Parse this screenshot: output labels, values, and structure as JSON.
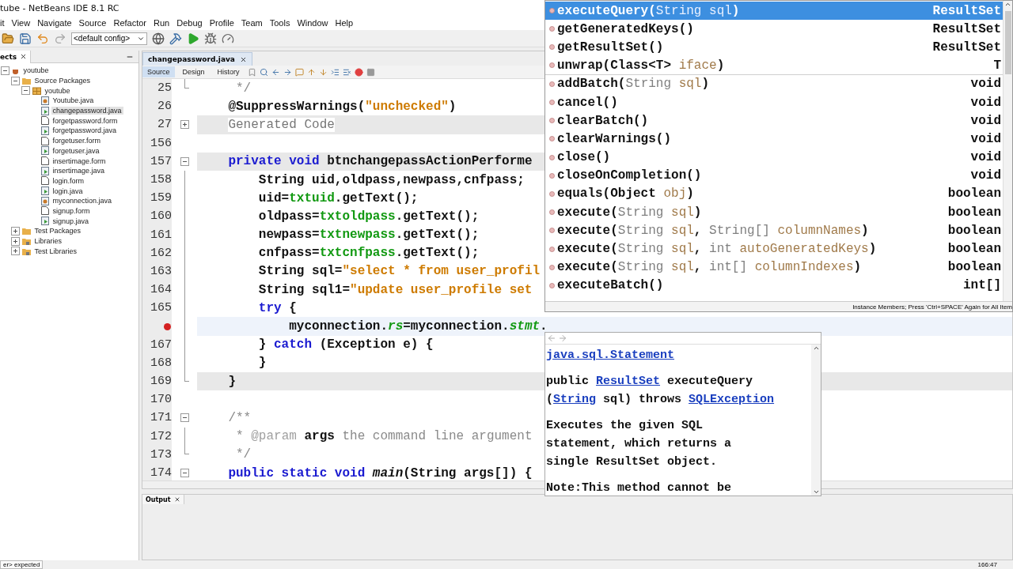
{
  "window": {
    "title": "tube - NetBeans IDE 8.1 RC"
  },
  "menu": [
    "it",
    "View",
    "Navigate",
    "Source",
    "Refactor",
    "Run",
    "Debug",
    "Profile",
    "Team",
    "Tools",
    "Window",
    "Help"
  ],
  "toolbar": {
    "config": "<default config>"
  },
  "projects": {
    "tab": "ects",
    "tree": [
      {
        "label": "youtube",
        "kind": "project",
        "expanded": true,
        "selected": false,
        "children": [
          {
            "label": "Source Packages",
            "kind": "folder",
            "expanded": true,
            "selected": false,
            "children": [
              {
                "label": "youtube",
                "kind": "package",
                "expanded": true,
                "selected": false,
                "children": [
                  {
                    "label": "Youtube.java",
                    "kind": "main",
                    "selected": false
                  },
                  {
                    "label": "changepassword.java",
                    "kind": "java",
                    "selected": true
                  },
                  {
                    "label": "forgetpassword.form",
                    "kind": "form",
                    "selected": false
                  },
                  {
                    "label": "forgetpassword.java",
                    "kind": "java",
                    "selected": false
                  },
                  {
                    "label": "forgetuser.form",
                    "kind": "form",
                    "selected": false
                  },
                  {
                    "label": "forgetuser.java",
                    "kind": "java",
                    "selected": false
                  },
                  {
                    "label": "insertimage.form",
                    "kind": "form",
                    "selected": false
                  },
                  {
                    "label": "insertimage.java",
                    "kind": "java",
                    "selected": false
                  },
                  {
                    "label": "login.form",
                    "kind": "form",
                    "selected": false
                  },
                  {
                    "label": "login.java",
                    "kind": "java",
                    "selected": false
                  },
                  {
                    "label": "myconnection.java",
                    "kind": "main",
                    "selected": false
                  },
                  {
                    "label": "signup.form",
                    "kind": "form",
                    "selected": false
                  },
                  {
                    "label": "signup.java",
                    "kind": "java",
                    "selected": false
                  }
                ]
              }
            ]
          },
          {
            "label": "Test Packages",
            "kind": "folder",
            "expanded": false,
            "selected": false
          },
          {
            "label": "Libraries",
            "kind": "library",
            "expanded": false,
            "selected": false
          },
          {
            "label": "Test Libraries",
            "kind": "library",
            "expanded": false,
            "selected": false
          }
        ]
      }
    ]
  },
  "editor": {
    "tab": "changepassword.java",
    "views": [
      {
        "label": "Source",
        "selected": true
      },
      {
        "label": "Design",
        "selected": false
      },
      {
        "label": "History",
        "selected": false
      }
    ],
    "lines": [
      {
        "number": "25",
        "kind": "normal",
        "fold": {
          "kind": "end"
        },
        "error": false,
        "tokens": [
          {
            "text": "     */",
            "kind": "comment"
          }
        ]
      },
      {
        "number": "26",
        "kind": "normal",
        "error": false,
        "tokens": [
          {
            "text": "    @SuppressWarnings(",
            "kind": "plain"
          },
          {
            "text": "\"unchecked\"",
            "kind": "string"
          },
          {
            "text": ")",
            "kind": "plain"
          }
        ]
      },
      {
        "number": "27",
        "kind": "guarded",
        "fold": {
          "kind": "expand"
        },
        "error": false,
        "tokens": [
          {
            "text": "    Generated Code",
            "kind": "folded"
          }
        ]
      },
      {
        "number": "156",
        "kind": "normal",
        "error": false
      },
      {
        "number": "157",
        "kind": "guarded",
        "fold": {
          "kind": "collapse"
        },
        "error": false,
        "tokens": [
          {
            "text": "    private void",
            "kind": "keyword"
          },
          {
            "text": " btnchangepassActionPerforme",
            "kind": "plain"
          }
        ]
      },
      {
        "number": "158",
        "kind": "normal",
        "fold": {
          "kind": "line"
        },
        "error": false,
        "tokens": [
          {
            "text": "        String uid,oldpass,newpass,cnfpass;",
            "kind": "plain"
          }
        ]
      },
      {
        "number": "159",
        "kind": "normal",
        "fold": {
          "kind": "line"
        },
        "error": false,
        "tokens": [
          {
            "text": "        uid=",
            "kind": "plain"
          },
          {
            "text": "txtuid",
            "kind": "field"
          },
          {
            "text": ".getText();",
            "kind": "plain"
          }
        ]
      },
      {
        "number": "160",
        "kind": "normal",
        "fold": {
          "kind": "line"
        },
        "error": false,
        "tokens": [
          {
            "text": "        oldpass=",
            "kind": "plain"
          },
          {
            "text": "txtoldpass",
            "kind": "field"
          },
          {
            "text": ".getText();",
            "kind": "plain"
          }
        ]
      },
      {
        "number": "161",
        "kind": "normal",
        "fold": {
          "kind": "line"
        },
        "error": false,
        "tokens": [
          {
            "text": "        newpass=",
            "kind": "plain"
          },
          {
            "text": "txtnewpass",
            "kind": "field"
          },
          {
            "text": ".getText();",
            "kind": "plain"
          }
        ]
      },
      {
        "number": "162",
        "kind": "normal",
        "fold": {
          "kind": "line"
        },
        "error": false,
        "tokens": [
          {
            "text": "        cnfpass=",
            "kind": "plain"
          },
          {
            "text": "txtcnfpass",
            "kind": "field"
          },
          {
            "text": ".getText();",
            "kind": "plain"
          }
        ]
      },
      {
        "number": "163",
        "kind": "normal",
        "fold": {
          "kind": "line"
        },
        "error": false,
        "tokens": [
          {
            "text": "        String sql=",
            "kind": "plain"
          },
          {
            "text": "\"select * from user_profil",
            "kind": "string"
          }
        ]
      },
      {
        "number": "164",
        "kind": "normal",
        "fold": {
          "kind": "line"
        },
        "error": false,
        "tokens": [
          {
            "text": "        String sql1=",
            "kind": "plain"
          },
          {
            "text": "\"update user_profile set",
            "kind": "string"
          }
        ]
      },
      {
        "number": "165",
        "kind": "normal",
        "fold": {
          "kind": "line"
        },
        "error": false,
        "tokens": [
          {
            "text": "        try",
            "kind": "keyword"
          },
          {
            "text": " {",
            "kind": "plain"
          }
        ]
      },
      {
        "kind": "caret",
        "fold": {
          "kind": "line"
        },
        "error": true,
        "tokens": [
          {
            "text": "            myconnection.",
            "kind": "plain"
          },
          {
            "text": "rs",
            "kind": "static"
          },
          {
            "text": "=myconnection.",
            "kind": "plain"
          },
          {
            "text": "stmt",
            "kind": "static"
          },
          {
            "text": ".",
            "kind": "plain"
          }
        ]
      },
      {
        "number": "167",
        "kind": "normal",
        "fold": {
          "kind": "line"
        },
        "error": false,
        "tokens": [
          {
            "text": "        } ",
            "kind": "plain"
          },
          {
            "text": "catch",
            "kind": "keyword"
          },
          {
            "text": " (Exception e) {",
            "kind": "plain"
          }
        ]
      },
      {
        "number": "168",
        "kind": "normal",
        "fold": {
          "kind": "line"
        },
        "error": false,
        "tokens": [
          {
            "text": "        }",
            "kind": "plain"
          }
        ]
      },
      {
        "number": "169",
        "kind": "guarded",
        "fold": {
          "kind": "end"
        },
        "error": false,
        "tokens": [
          {
            "text": "    }",
            "kind": "plain"
          }
        ]
      },
      {
        "number": "170",
        "kind": "normal",
        "error": false
      },
      {
        "number": "171",
        "kind": "normal",
        "fold": {
          "kind": "collapse"
        },
        "error": false,
        "tokens": [
          {
            "text": "    /**",
            "kind": "comment"
          }
        ]
      },
      {
        "number": "172",
        "kind": "normal",
        "fold": {
          "kind": "line"
        },
        "error": false,
        "tokens": [
          {
            "text": "     * ",
            "kind": "comment"
          },
          {
            "text": "@param",
            "kind": "tag"
          },
          {
            "text": " args",
            "kind": "plain"
          },
          {
            "text": " the command line argument",
            "kind": "comment"
          }
        ]
      },
      {
        "number": "173",
        "kind": "normal",
        "fold": {
          "kind": "end"
        },
        "error": false,
        "tokens": [
          {
            "text": "     */",
            "kind": "comment"
          }
        ]
      },
      {
        "number": "174",
        "kind": "normal",
        "fold": {
          "kind": "collapse"
        },
        "error": false,
        "tokens": [
          {
            "text": "    public static void ",
            "kind": "keyword"
          },
          {
            "text": "main",
            "kind": "italic"
          },
          {
            "text": "(String args[]) {",
            "kind": "plain"
          }
        ]
      }
    ]
  },
  "completion": {
    "items": [
      {
        "signature": [
          {
            "text": "executeQuery",
            "kind": "name"
          },
          {
            "text": "(",
            "kind": "punct"
          },
          {
            "text": "String",
            "kind": "type"
          },
          {
            "text": " sql",
            "kind": "param"
          },
          {
            "text": ")",
            "kind": "punct"
          }
        ],
        "type": "ResultSet",
        "selected": true,
        "separator": false
      },
      {
        "signature": [
          {
            "text": "getGeneratedKeys",
            "kind": "name"
          },
          {
            "text": "()",
            "kind": "punct"
          }
        ],
        "type": "ResultSet",
        "selected": false,
        "separator": false
      },
      {
        "signature": [
          {
            "text": "getResultSet",
            "kind": "name"
          },
          {
            "text": "()",
            "kind": "punct"
          }
        ],
        "type": "ResultSet",
        "selected": false,
        "separator": false
      },
      {
        "signature": [
          {
            "text": "unwrap",
            "kind": "name"
          },
          {
            "text": "(Class<T>",
            "kind": "punct"
          },
          {
            "text": " iface",
            "kind": "param"
          },
          {
            "text": ")",
            "kind": "punct"
          }
        ],
        "type": "T",
        "selected": false,
        "separator": true
      },
      {
        "signature": [
          {
            "text": "addBatch",
            "kind": "name"
          },
          {
            "text": "(",
            "kind": "punct"
          },
          {
            "text": "String",
            "kind": "type"
          },
          {
            "text": " sql",
            "kind": "param"
          },
          {
            "text": ")",
            "kind": "punct"
          }
        ],
        "type": "void",
        "selected": false,
        "separator": false
      },
      {
        "signature": [
          {
            "text": "cancel",
            "kind": "name"
          },
          {
            "text": "()",
            "kind": "punct"
          }
        ],
        "type": "void",
        "selected": false,
        "separator": false
      },
      {
        "signature": [
          {
            "text": "clearBatch",
            "kind": "name"
          },
          {
            "text": "()",
            "kind": "punct"
          }
        ],
        "type": "void",
        "selected": false,
        "separator": false
      },
      {
        "signature": [
          {
            "text": "clearWarnings",
            "kind": "name"
          },
          {
            "text": "()",
            "kind": "punct"
          }
        ],
        "type": "void",
        "selected": false,
        "separator": false
      },
      {
        "signature": [
          {
            "text": "close",
            "kind": "name"
          },
          {
            "text": "()",
            "kind": "punct"
          }
        ],
        "type": "void",
        "selected": false,
        "separator": false
      },
      {
        "signature": [
          {
            "text": "closeOnCompletion",
            "kind": "name"
          },
          {
            "text": "()",
            "kind": "punct"
          }
        ],
        "type": "void",
        "selected": false,
        "separator": false
      },
      {
        "signature": [
          {
            "text": "equals",
            "kind": "name"
          },
          {
            "text": "(Object",
            "kind": "punct"
          },
          {
            "text": " obj",
            "kind": "param"
          },
          {
            "text": ")",
            "kind": "punct"
          }
        ],
        "type": "boolean",
        "selected": false,
        "separator": false
      },
      {
        "signature": [
          {
            "text": "execute",
            "kind": "name"
          },
          {
            "text": "(",
            "kind": "punct"
          },
          {
            "text": "String",
            "kind": "type"
          },
          {
            "text": " sql",
            "kind": "param"
          },
          {
            "text": ")",
            "kind": "punct"
          }
        ],
        "type": "boolean",
        "selected": false,
        "separator": false
      },
      {
        "signature": [
          {
            "text": "execute",
            "kind": "name"
          },
          {
            "text": "(",
            "kind": "punct"
          },
          {
            "text": "String",
            "kind": "type"
          },
          {
            "text": " sql",
            "kind": "param"
          },
          {
            "text": ",",
            "kind": "punct"
          },
          {
            "text": " String[]",
            "kind": "type"
          },
          {
            "text": " columnNames",
            "kind": "param"
          },
          {
            "text": ")",
            "kind": "punct"
          }
        ],
        "type": "boolean",
        "selected": false,
        "separator": false
      },
      {
        "signature": [
          {
            "text": "execute",
            "kind": "name"
          },
          {
            "text": "(",
            "kind": "punct"
          },
          {
            "text": "String",
            "kind": "type"
          },
          {
            "text": " sql",
            "kind": "param"
          },
          {
            "text": ",",
            "kind": "punct"
          },
          {
            "text": " int",
            "kind": "type"
          },
          {
            "text": " autoGeneratedKeys",
            "kind": "param"
          },
          {
            "text": ")",
            "kind": "punct"
          }
        ],
        "type": "boolean",
        "selected": false,
        "separator": false
      },
      {
        "signature": [
          {
            "text": "execute",
            "kind": "name"
          },
          {
            "text": "(",
            "kind": "punct"
          },
          {
            "text": "String",
            "kind": "type"
          },
          {
            "text": " sql",
            "kind": "param"
          },
          {
            "text": ",",
            "kind": "punct"
          },
          {
            "text": " int[]",
            "kind": "type"
          },
          {
            "text": " columnIndexes",
            "kind": "param"
          },
          {
            "text": ")",
            "kind": "punct"
          }
        ],
        "type": "boolean",
        "selected": false,
        "separator": false
      },
      {
        "signature": [
          {
            "text": "executeBatch",
            "kind": "name"
          },
          {
            "text": "()",
            "kind": "punct"
          }
        ],
        "type": "int[]",
        "selected": false,
        "separator": false
      }
    ],
    "footer": "Instance Members; Press 'Ctrl+SPACE' Again for All Item"
  },
  "javadoc": {
    "class_link": "java.sql.Statement",
    "signature": [
      {
        "text": "public ",
        "link": false
      },
      {
        "text": "ResultSet",
        "link": true
      },
      {
        "text": " executeQuery ",
        "link": false
      },
      {
        "text": "(",
        "link": false
      },
      {
        "text": "String",
        "link": true
      },
      {
        "text": " sql) throws ",
        "link": false
      },
      {
        "text": "SQLException",
        "link": true
      }
    ],
    "description": "Executes the given SQL statement, which returns a single ResultSet object.",
    "note": "Note:This method cannot be"
  },
  "output": {
    "tab": "Output"
  },
  "status": {
    "message": "er> expected",
    "position": "166:47"
  }
}
